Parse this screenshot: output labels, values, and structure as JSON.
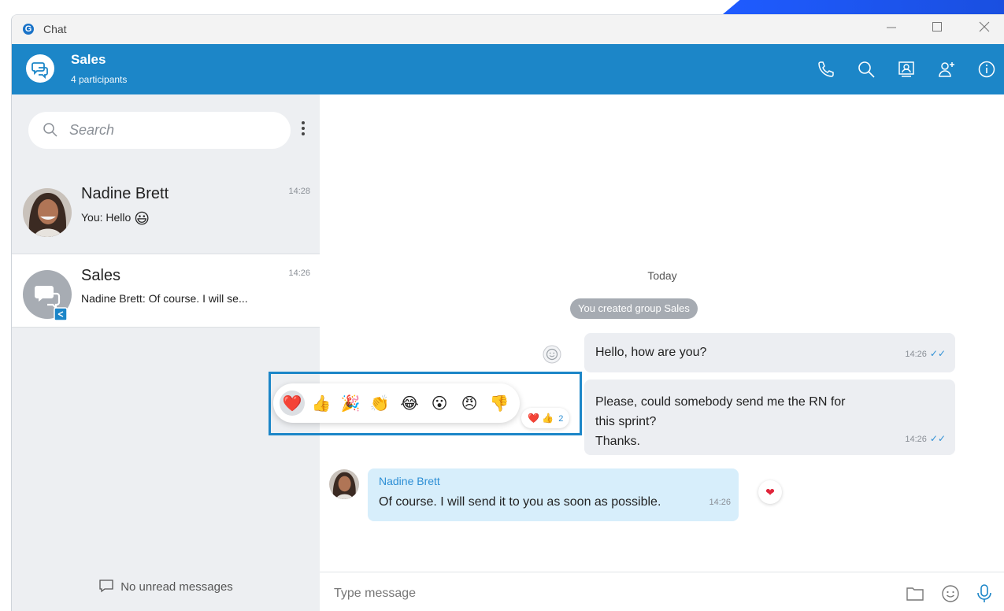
{
  "window": {
    "app_name": "Chat",
    "logo_letter": "G"
  },
  "header": {
    "title": "Sales",
    "subtitle": "4 participants"
  },
  "sidebar": {
    "search": {
      "placeholder": "Search"
    },
    "conversations": [
      {
        "name": "Nadine Brett",
        "time": "14:28",
        "preview": "You: Hello",
        "preview_emoji": "😃"
      },
      {
        "name": "Sales",
        "time": "14:26",
        "preview": "Nadine Brett: Of course. I will se..."
      }
    ],
    "unread_label": "No unread messages"
  },
  "chat": {
    "date_label": "Today",
    "system_message": "You created group Sales",
    "messages": [
      {
        "text": "Hello, how are you?",
        "time": "14:26",
        "status": "✓✓"
      },
      {
        "text_line1": "Please, could somebody send me the RN for",
        "text_line2": "this sprint?",
        "text_line3": "Thanks.",
        "time": "14:26",
        "status": "✓✓"
      },
      {
        "author": "Nadine Brett",
        "text": "Of course. I will send it to you as soon as possible.",
        "time": "14:26",
        "reaction": "❤"
      }
    ],
    "reaction_summary": {
      "emojis": "❤️ 👍",
      "count": "2"
    },
    "composer": {
      "placeholder": "Type message"
    }
  },
  "reaction_picker": {
    "options": [
      "❤️",
      "👍",
      "🎉",
      "👏",
      "😂",
      "😮",
      "😠",
      "👎"
    ]
  },
  "colors": {
    "accent": "#1c86c8",
    "sidebar_bg": "#edeff2",
    "bubble_out": "#eceef2",
    "bubble_in": "#d7eefb",
    "corner": "#1f5bff"
  }
}
